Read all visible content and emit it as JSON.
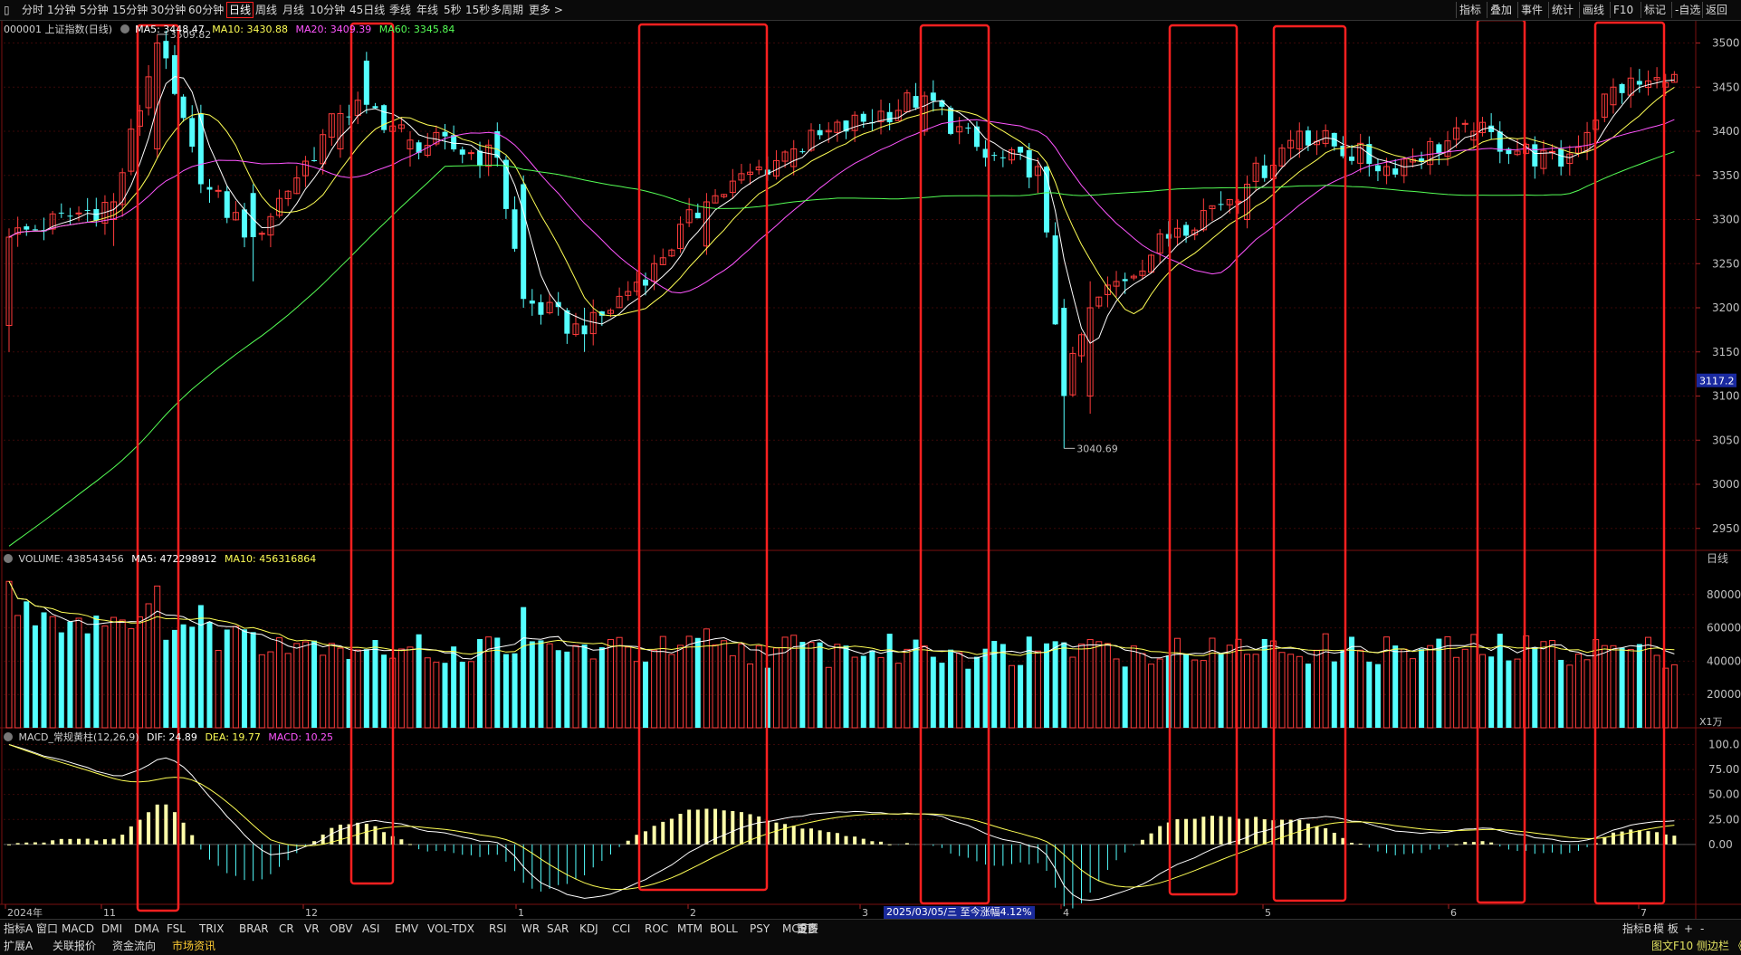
{
  "toolbar": {
    "periods": [
      "分时",
      "1分钟",
      "5分钟",
      "15分钟",
      "30分钟",
      "60分钟",
      "日线",
      "周线",
      "月线",
      "10分钟",
      "45日线",
      "季线",
      "年线",
      "5秒",
      "15秒",
      "多周期",
      "更多 >"
    ],
    "active_period": "日线",
    "right_items": [
      "指标",
      "叠加",
      "事件",
      "统计",
      "画线",
      "F10",
      "标记",
      "-自选",
      "返回"
    ]
  },
  "price_panel": {
    "title": "000001 上证指数(日线)",
    "ma5": "MA5: 3448.47",
    "ma10": "MA10: 3430.88",
    "ma20": "MA20: 3409.39",
    "ma60": "MA60: 3345.84",
    "high_label": "3509.82",
    "low_label": "3040.69",
    "current_price": "3117.2",
    "y_ticks": [
      "3500",
      "3450",
      "3400",
      "3350",
      "3300",
      "3250",
      "3200",
      "3150",
      "3100",
      "3050",
      "3000",
      "2950"
    ]
  },
  "volume_panel": {
    "title": "VOLUME: 438543456",
    "ma5": "MA5: 472298912",
    "ma10": "MA10: 456316864",
    "y_ticks": [
      "80000",
      "60000",
      "40000",
      "20000"
    ],
    "unit": "X1万",
    "period_label": "日线"
  },
  "macd_panel": {
    "title": "MACD_常规黄柱(12,26,9)",
    "dif": "DIF: 24.89",
    "dea": "DEA: 19.77",
    "macd": "MACD: 10.25",
    "y_ticks": [
      "100.0",
      "75.00",
      "50.00",
      "25.00",
      "0.00"
    ]
  },
  "x_axis": {
    "labels": [
      "2024年",
      "11",
      "12",
      "1",
      "2",
      "3",
      "4",
      "5",
      "6",
      "7"
    ],
    "date_info": "2025/03/05/三  至今涨幅4.12%"
  },
  "indicator_tabs": [
    "指标A",
    "窗口",
    "MACD",
    "DMI",
    "DMA",
    "FSL",
    "TRIX",
    "BRAR",
    "CR",
    "VR",
    "OBV",
    "ASI",
    "EMV",
    "VOL-TDX",
    "RSI",
    "WR",
    "SAR",
    "KDJ",
    "CCI",
    "ROC",
    "MTM",
    "BOLL",
    "PSY",
    "MCST",
    "更多",
    "设置"
  ],
  "right_tabs": [
    "指标B",
    "模 板",
    "+",
    "-"
  ],
  "bottom_row": [
    "扩展A",
    "关联报价",
    "资金流向",
    "市场资讯"
  ],
  "bottom_right": "图文F10 侧边栏 《",
  "colors": {
    "up": "#ff3c3c",
    "down": "#54ffff",
    "ma5": "#ffffff",
    "ma10": "#ffff55",
    "ma20": "#ff55ff",
    "ma60": "#55ff55",
    "highlight_box": "#ff2020",
    "macd_bar": "#ffffaa"
  },
  "chart_data": {
    "type": "candlestick",
    "y_range_price": [
      2920,
      3520
    ],
    "y_range_volume_wan": [
      0,
      100000
    ],
    "y_range_macd": [
      -60,
      115
    ],
    "anchor_points": [
      {
        "idx": 0,
        "o": 3180,
        "c": 3280,
        "h": 3290,
        "l": 3150
      },
      {
        "idx": 12,
        "o": 3300,
        "c": 3320,
        "h": 3330,
        "l": 3270
      },
      {
        "idx": 17,
        "o": 3380,
        "c": 3500,
        "h": 3509.82,
        "l": 3370
      },
      {
        "idx": 22,
        "o": 3420,
        "c": 3340,
        "h": 3430,
        "l": 3330
      },
      {
        "idx": 28,
        "o": 3330,
        "c": 3280,
        "h": 3340,
        "l": 3230
      },
      {
        "idx": 38,
        "o": 3380,
        "c": 3420,
        "h": 3430,
        "l": 3370
      },
      {
        "idx": 41,
        "o": 3480,
        "c": 3430,
        "h": 3490,
        "l": 3420
      },
      {
        "idx": 46,
        "o": 3380,
        "c": 3390,
        "h": 3400,
        "l": 3360
      },
      {
        "idx": 56,
        "o": 3400,
        "c": 3370,
        "h": 3410,
        "l": 3360
      },
      {
        "idx": 59,
        "o": 3340,
        "c": 3210,
        "h": 3350,
        "l": 3200
      },
      {
        "idx": 66,
        "o": 3180,
        "c": 3170,
        "h": 3200,
        "l": 3150
      },
      {
        "idx": 74,
        "o": 3230,
        "c": 3250,
        "h": 3260,
        "l": 3220
      },
      {
        "idx": 80,
        "o": 3270,
        "c": 3320,
        "h": 3330,
        "l": 3260
      },
      {
        "idx": 90,
        "o": 3360,
        "c": 3380,
        "h": 3390,
        "l": 3350
      },
      {
        "idx": 105,
        "o": 3400,
        "c": 3440,
        "h": 3445,
        "l": 3395
      },
      {
        "idx": 112,
        "o": 3380,
        "c": 3370,
        "h": 3390,
        "l": 3360
      },
      {
        "idx": 118,
        "o": 3350,
        "c": 3360,
        "h": 3370,
        "l": 3330
      },
      {
        "idx": 121,
        "o": 3200,
        "c": 3100,
        "h": 3210,
        "l": 3040.69
      },
      {
        "idx": 124,
        "o": 3100,
        "c": 3200,
        "h": 3230,
        "l": 3080
      },
      {
        "idx": 134,
        "o": 3280,
        "c": 3290,
        "h": 3300,
        "l": 3270
      },
      {
        "idx": 142,
        "o": 3300,
        "c": 3340,
        "h": 3350,
        "l": 3290
      },
      {
        "idx": 148,
        "o": 3380,
        "c": 3400,
        "h": 3410,
        "l": 3370
      },
      {
        "idx": 158,
        "o": 3350,
        "c": 3360,
        "h": 3370,
        "l": 3340
      },
      {
        "idx": 168,
        "o": 3390,
        "c": 3400,
        "h": 3410,
        "l": 3380
      },
      {
        "idx": 178,
        "o": 3380,
        "c": 3360,
        "h": 3390,
        "l": 3350
      },
      {
        "idx": 184,
        "o": 3430,
        "c": 3450,
        "h": 3460,
        "l": 3420
      },
      {
        "idx": 190,
        "o": 3450,
        "c": 3455,
        "h": 3465,
        "l": 3440
      }
    ]
  }
}
